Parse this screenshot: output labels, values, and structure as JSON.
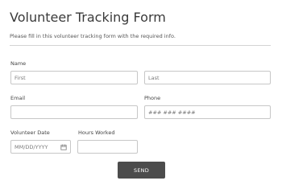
{
  "form": {
    "title": "Volunteer Tracking Form",
    "description": "Please fill in this volunteer tracking form with the required info."
  },
  "fields": {
    "name": {
      "label": "Name",
      "first_placeholder": "First",
      "last_placeholder": "Last"
    },
    "email": {
      "label": "Email",
      "placeholder": ""
    },
    "phone": {
      "label": "Phone",
      "placeholder": "### ### ####"
    },
    "volunteer_date": {
      "label": "Volunteer Date",
      "placeholder": "MM/DD/YYYY",
      "icon": "calendar-icon"
    },
    "hours_worked": {
      "label": "Hours Worked",
      "placeholder": ""
    }
  },
  "actions": {
    "send_label": "SEND"
  },
  "colors": {
    "button_bg": "#4c4c4c",
    "border": "#c7c7c7",
    "divider": "#d4d4d4"
  }
}
